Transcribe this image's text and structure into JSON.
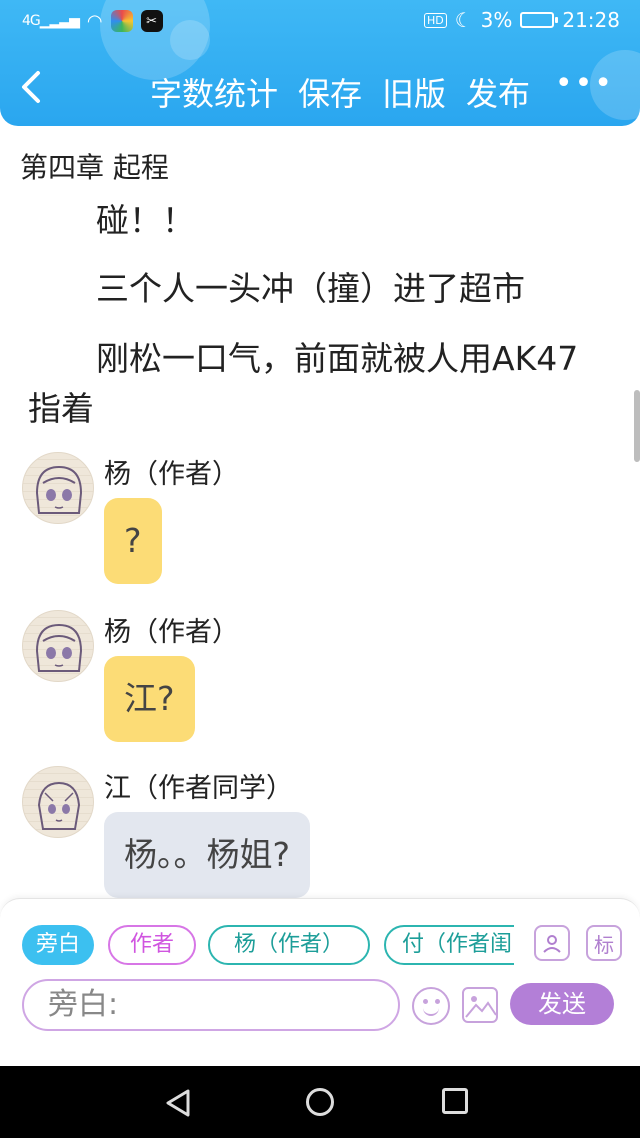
{
  "status_bar": {
    "network": "4G",
    "battery": "3%",
    "time": "21:28",
    "hd": "HD"
  },
  "header": {
    "back_icon": "chevron-left-icon",
    "menu": [
      "字数统计",
      "保存",
      "旧版",
      "发布"
    ],
    "more": "•••"
  },
  "story": {
    "chapter_title": "第四章 起程",
    "paragraphs": [
      "碰！！",
      "三个人一头冲（撞）进了超市",
      "刚松一口气，前面就被人用AK47指着"
    ]
  },
  "messages": [
    {
      "speaker": "杨（作者）",
      "text": "?",
      "bubble_color": "#fcdc76"
    },
    {
      "speaker": "杨（作者）",
      "text": "江?",
      "bubble_color": "#fcdc76"
    },
    {
      "speaker": "江（作者同学）",
      "text": "杨。。杨姐?",
      "bubble_color": "#e3e7ef"
    }
  ],
  "composer": {
    "roles": [
      "旁白",
      "作者",
      "杨（作者）",
      "付（作者闺"
    ],
    "tool_mark_label": "标",
    "input_placeholder": "旁白:",
    "send_label": "发送"
  },
  "colors": {
    "header": "#2aa6ef",
    "send": "#b37fd7",
    "role_active": "#3cc0f0"
  }
}
